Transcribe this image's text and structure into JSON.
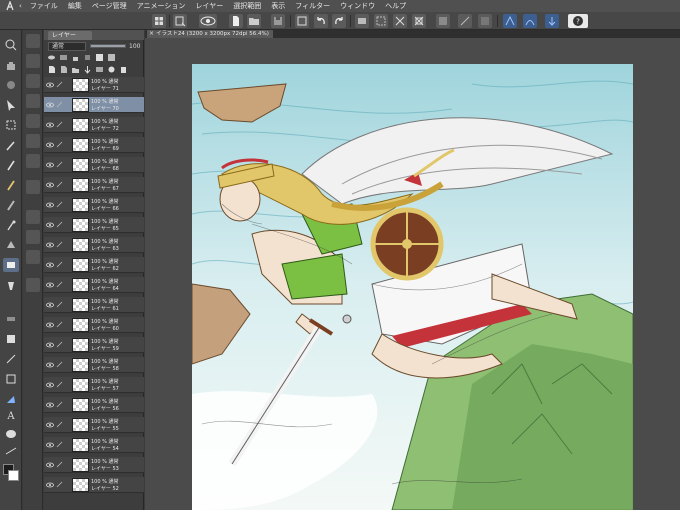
{
  "menu": [
    "ファイル",
    "編集",
    "ページ管理",
    "アニメーション",
    "レイヤー",
    "選択範囲",
    "表示",
    "フィルター",
    "ウィンドウ",
    "ヘルプ"
  ],
  "layer_panel": {
    "tab_label": "レイヤー",
    "blend_mode": "通常",
    "opacity": "100",
    "opacity_fraction": 1.0
  },
  "document": {
    "tab_title": "イラスト24 (3200 x 3200px 72dpi 56.4%)"
  },
  "layers": [
    {
      "mode": "100 % 通常",
      "name": "レイヤー 71",
      "selected": false
    },
    {
      "mode": "100 % 通常",
      "name": "レイヤー 70",
      "selected": true
    },
    {
      "mode": "100 % 通常",
      "name": "レイヤー 72",
      "selected": false
    },
    {
      "mode": "100 % 通常",
      "name": "レイヤー 69",
      "selected": false
    },
    {
      "mode": "100 % 通常",
      "name": "レイヤー 68",
      "selected": false
    },
    {
      "mode": "100 % 通常",
      "name": "レイヤー 67",
      "selected": false
    },
    {
      "mode": "100 % 通常",
      "name": "レイヤー 66",
      "selected": false
    },
    {
      "mode": "100 % 通常",
      "name": "レイヤー 65",
      "selected": false
    },
    {
      "mode": "100 % 通常",
      "name": "レイヤー 63",
      "selected": false
    },
    {
      "mode": "100 % 通常",
      "name": "レイヤー 62",
      "selected": false
    },
    {
      "mode": "100 % 通常",
      "name": "レイヤー 64",
      "selected": false
    },
    {
      "mode": "100 % 通常",
      "name": "レイヤー 61",
      "selected": false
    },
    {
      "mode": "100 % 通常",
      "name": "レイヤー 60",
      "selected": false
    },
    {
      "mode": "100 % 通常",
      "name": "レイヤー 59",
      "selected": false
    },
    {
      "mode": "100 % 通常",
      "name": "レイヤー 58",
      "selected": false
    },
    {
      "mode": "100 % 通常",
      "name": "レイヤー 57",
      "selected": false
    },
    {
      "mode": "100 % 通常",
      "name": "レイヤー 56",
      "selected": false
    },
    {
      "mode": "100 % 通常",
      "name": "レイヤー 55",
      "selected": false
    },
    {
      "mode": "100 % 通常",
      "name": "レイヤー 54",
      "selected": false
    },
    {
      "mode": "100 % 通常",
      "name": "レイヤー 53",
      "selected": false
    },
    {
      "mode": "100 % 通常",
      "name": "レイヤー 52",
      "selected": false
    }
  ],
  "colors": {
    "selected_layer": "#7e8fa6",
    "panel_bg": "#3d3d3d",
    "canvas_bg": "#4b4b4b",
    "sky": "#cfe6ea",
    "armor_green": "#7bc043",
    "shield_brown": "#7a3f22",
    "sash_red": "#c4323a",
    "hair_gold": "#e2c66a"
  },
  "icons": {
    "app_logo": "app-logo-icon",
    "tools": [
      "zoom-icon",
      "hand-icon",
      "move-icon",
      "operation-icon",
      "selection-icon",
      "eyedropper-icon",
      "pen-icon",
      "pencil-icon",
      "brush-icon",
      "airbrush-icon",
      "decoration-icon",
      "eraser-icon",
      "fill-icon",
      "gradient-icon",
      "figure-icon",
      "frame-icon",
      "ruler-icon",
      "text-icon",
      "balloon-icon",
      "correction-icon"
    ]
  }
}
